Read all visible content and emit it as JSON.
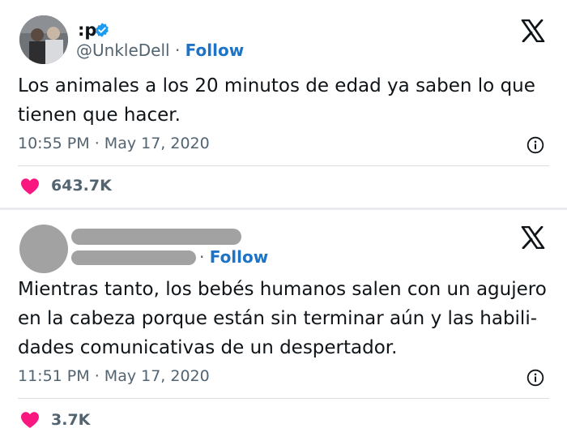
{
  "tweets": [
    {
      "author_name": ":p",
      "handle": "@UnkleDell",
      "separator": "·",
      "follow_label": "Follow",
      "text": "Los animales a los 20 minutos de edad ya saben lo que tienen que hacer.",
      "time": "10:55 PM",
      "date": "May 17, 2020",
      "meta_separator": "·",
      "likes": "643.7K"
    },
    {
      "separator": "·",
      "follow_label": "Follow",
      "text": "Mientras tanto, los bebés humanos salen con un agujero en la cabeza porque están sin terminar aún y las habili-dades comunicativas de un despertador.",
      "time": "11:51 PM",
      "date": "May 17, 2020",
      "meta_separator": "·",
      "likes": "3.7K"
    }
  ],
  "icons": {
    "verified": "verified-badge-icon",
    "close": "x-logo-icon",
    "info": "info-icon",
    "like": "heart-icon"
  },
  "colors": {
    "follow_blue": "#1d74c7",
    "verified_blue": "#1d9bf0",
    "heart_pink": "#f91880",
    "muted_text": "#536471",
    "redaction_gray": "#a2a2a2"
  }
}
